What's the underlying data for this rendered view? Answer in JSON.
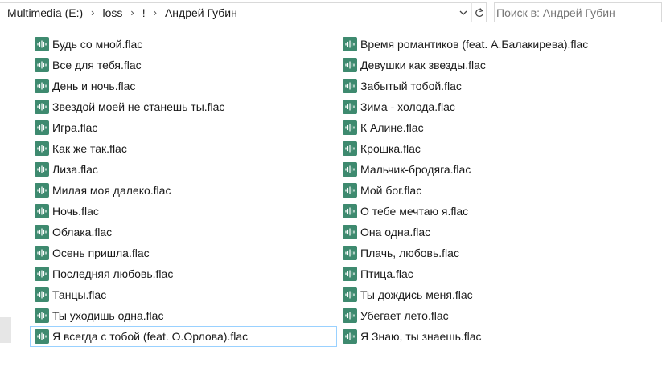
{
  "address_bar": {
    "crumbs": [
      "Multimedia (E:)",
      "loss",
      "!",
      "Андрей Губин"
    ],
    "separator": "›"
  },
  "search": {
    "placeholder": "Поиск в: Андрей Губин"
  },
  "icons": {
    "file": "audio-file-icon",
    "dropdown": "chevron-down-icon",
    "refresh": "refresh-icon",
    "search": "search-icon"
  },
  "colors": {
    "file_icon": "#3e8a6f",
    "selection_border": "#99d1ff"
  },
  "files": {
    "column_1": [
      "Будь со мной.flac",
      "Все для тебя.flac",
      "День и ночь.flac",
      "Звездой моей не станешь ты.flac",
      "Игра.flac",
      "Как же так.flac",
      "Лиза.flac",
      "Милая моя далеко.flac",
      "Ночь.flac",
      "Облака.flac",
      "Осень пришла.flac",
      "Последняя любовь.flac",
      "Танцы.flac",
      "Ты уходишь одна.flac",
      "Я всегда с тобой (feat. О.Орлова).flac"
    ],
    "column_2": [
      "Время романтиков (feat. А.Балакирева).flac",
      "Девушки как звезды.flac",
      "Забытый тобой.flac",
      "Зима - холода.flac",
      "К Алине.flac",
      "Крошка.flac",
      "Мальчик-бродяга.flac",
      "Мой бог.flac",
      "О тебе мечтаю я.flac",
      "Она одна.flac",
      "Плачь, любовь.flac",
      "Птица.flac",
      "Ты дождись меня.flac",
      "Убегает лето.flac",
      "Я Знаю, ты знаешь.flac"
    ],
    "selected": "Я всегда с тобой (feat. О.Орлова).flac"
  }
}
